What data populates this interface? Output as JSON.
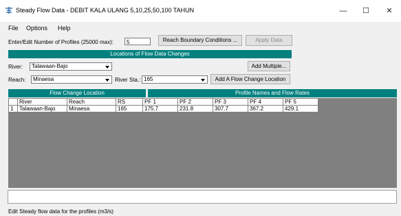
{
  "window": {
    "title": "Steady Flow Data - DEBIT KALA ULANG 5,10,25,50,100 TAHUN",
    "minimize": "—",
    "maximize": "☐",
    "close": "✕"
  },
  "menu": {
    "file": "File",
    "options": "Options",
    "help": "Help"
  },
  "profiles": {
    "label": "Enter/Edit Number of Profiles (25000 max):",
    "value": "5",
    "reach_boundary_button": "Reach Boundary Conditions ...",
    "apply_button": "Apply Data"
  },
  "locations": {
    "header": "Locations of Flow Data Changes",
    "river_label": "River:",
    "river_value": "Talawaan-Bajo",
    "add_multiple_button": "Add Multiple...",
    "reach_label": "Reach:",
    "reach_value": "Minaesa",
    "river_sta_label": "River Sta.:",
    "river_sta_value": "165",
    "add_location_button": "Add A Flow Change Location"
  },
  "section_headers": {
    "flow_change": "Flow Change Location",
    "profile_names": "Profile Names and Flow Rates"
  },
  "table": {
    "columns": [
      "River",
      "Reach",
      "RS",
      "PF 1",
      "PF 2",
      "PF 3",
      "PF 4",
      "PF 5"
    ],
    "rows": [
      {
        "index": "1",
        "river": "Talawaan-Bajo",
        "reach": "Minaesa",
        "rs": "165",
        "pf1": "175.7",
        "pf2": "231.8",
        "pf3": "307.7",
        "pf4": "367.2",
        "pf5": "429.1"
      }
    ]
  },
  "status": {
    "text": "Edit Steady flow data for the profiles (m3/s)"
  },
  "colors": {
    "section_header": "#00807f",
    "grid_background": "#808080"
  }
}
